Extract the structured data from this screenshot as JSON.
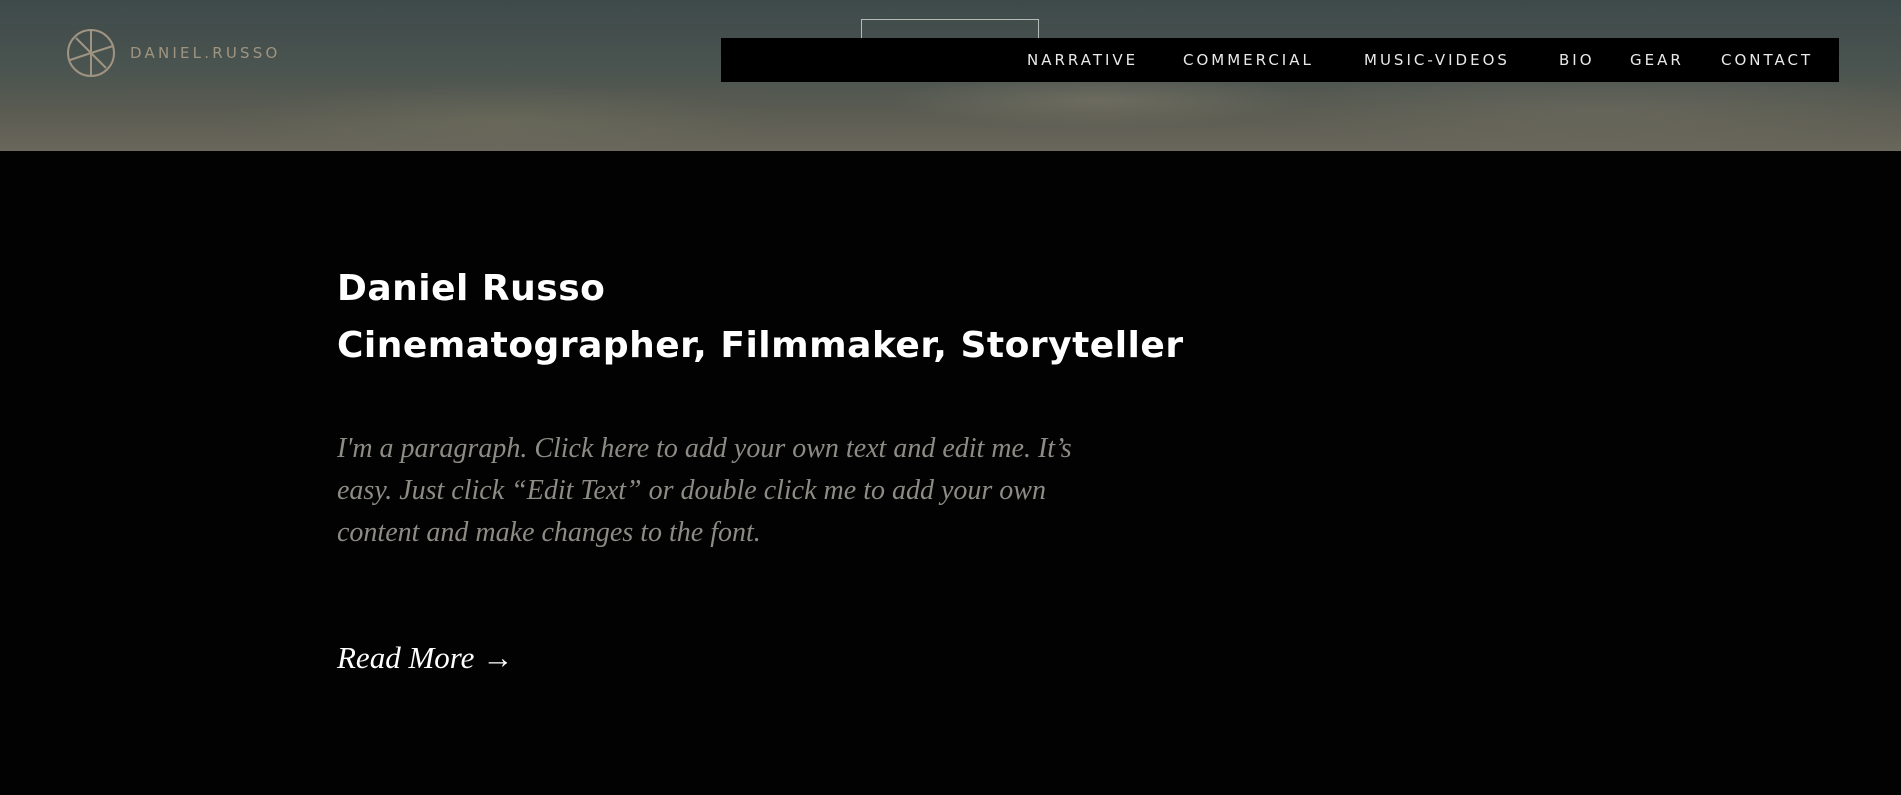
{
  "header": {
    "logo_icon": "monogram-circle-icon",
    "logo_text": "DANIEL.RUSSO",
    "accent_color": "#9f9481"
  },
  "nav": {
    "items": [
      {
        "label": "NARRATIVE"
      },
      {
        "label": "COMMERCIAL"
      },
      {
        "label": "MUSIC-VIDEOS"
      },
      {
        "label": "BIO"
      },
      {
        "label": "GEAR"
      },
      {
        "label": "CONTACT"
      }
    ]
  },
  "main": {
    "name": "Daniel Russo",
    "tagline": "Cinematographer, Filmmaker, Storyteller",
    "paragraph": "I'm a paragraph. Click here to add your own text and edit me. It’s easy. Just click “Edit Text” or double click me to add your own content and make changes to the font.",
    "read_more": "Read More →"
  }
}
